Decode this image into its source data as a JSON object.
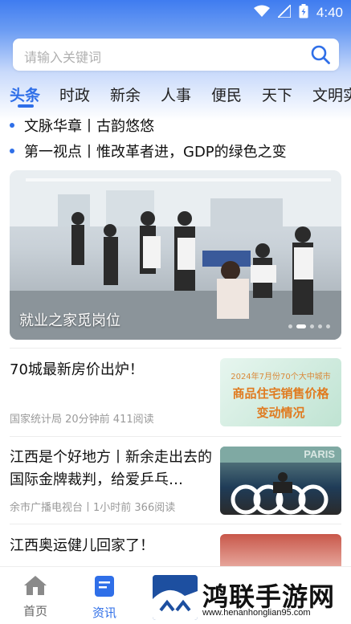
{
  "status": {
    "time": "4:40"
  },
  "search": {
    "placeholder": "请输入关键词"
  },
  "tabs": [
    {
      "label": "头条",
      "active": true
    },
    {
      "label": "时政"
    },
    {
      "label": "新余"
    },
    {
      "label": "人事"
    },
    {
      "label": "便民"
    },
    {
      "label": "天下"
    },
    {
      "label": "文明实"
    }
  ],
  "headlines": [
    "文脉华章丨古韵悠悠",
    "第一视点丨惟改革者进，GDP的绿色之变"
  ],
  "hero": {
    "caption": "就业之家觅岗位",
    "slides": 5,
    "active_slide": 2
  },
  "news": [
    {
      "title": "70城最新房价出炉！",
      "meta": "国家统计局  20分钟前  411阅读",
      "thumb_lines": [
        "2024年7月份70个大中城市",
        "商品住宅销售价格",
        "变动情况"
      ]
    },
    {
      "title": "江西是个好地方丨新余走出去的国际金牌裁判，给爱乒乓…",
      "meta": "余市广播电视台丨1小时前  366阅读",
      "thumb_text": "PARIS"
    },
    {
      "title": "江西奥运健儿回家了！",
      "meta": ""
    }
  ],
  "bottom_nav": [
    {
      "label": "首页",
      "icon": "home-icon",
      "active": false
    },
    {
      "label": "资讯",
      "icon": "news-icon",
      "active": true
    }
  ],
  "brand": {
    "title": "鸿联手游网",
    "url": "www.henanhonglian95.com"
  },
  "colors": {
    "accent": "#2f6fe8",
    "header_blue": "#3f7cf0"
  }
}
